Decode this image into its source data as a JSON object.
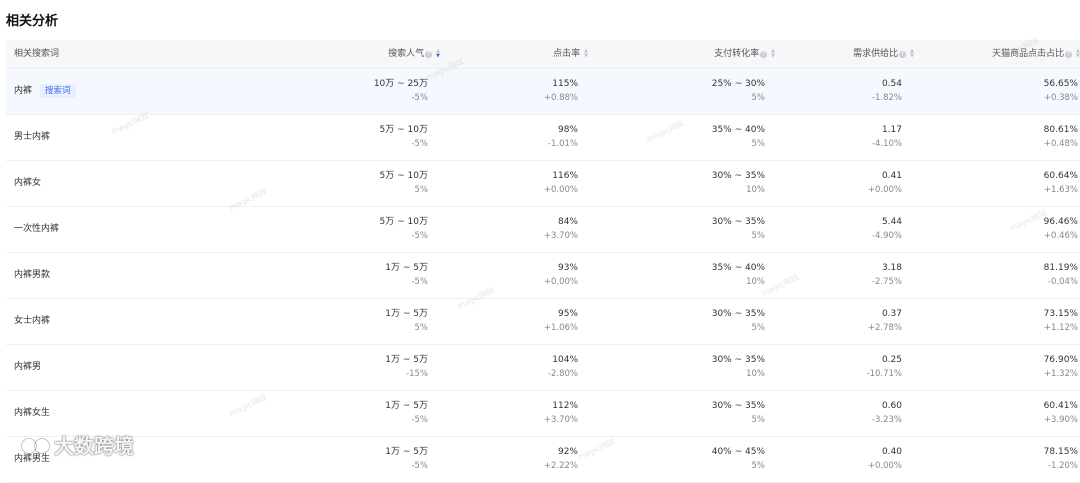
{
  "page": {
    "title": "相关分析"
  },
  "columns": [
    {
      "label": "相关搜索词"
    },
    {
      "label": "搜索人气"
    },
    {
      "label": "点击率"
    },
    {
      "label": "支付转化率"
    },
    {
      "label": "需求供给比"
    },
    {
      "label": "天猫商品点击占比"
    }
  ],
  "tag_label": "搜索词",
  "rows": [
    {
      "term": "内裤",
      "search": "10万 ~ 25万",
      "search_d": "-5%",
      "ctr": "115%",
      "ctr_d": "+0.88%",
      "conv": "25% ~ 30%",
      "conv_d": "5%",
      "sd": "0.54",
      "sd_d": "-1.82%",
      "tmall": "56.65%",
      "tmall_d": "+0.38%"
    },
    {
      "term": "男士内裤",
      "search": "5万 ~ 10万",
      "search_d": "-5%",
      "ctr": "98%",
      "ctr_d": "-1.01%",
      "conv": "35% ~ 40%",
      "conv_d": "5%",
      "sd": "1.17",
      "sd_d": "-4.10%",
      "tmall": "80.61%",
      "tmall_d": "+0.48%"
    },
    {
      "term": "内裤女",
      "search": "5万 ~ 10万",
      "search_d": "5%",
      "ctr": "116%",
      "ctr_d": "+0.00%",
      "conv": "30% ~ 35%",
      "conv_d": "10%",
      "sd": "0.41",
      "sd_d": "+0.00%",
      "tmall": "60.64%",
      "tmall_d": "+1.63%"
    },
    {
      "term": "一次性内裤",
      "search": "5万 ~ 10万",
      "search_d": "-5%",
      "ctr": "84%",
      "ctr_d": "+3.70%",
      "conv": "30% ~ 35%",
      "conv_d": "5%",
      "sd": "5.44",
      "sd_d": "-4.90%",
      "tmall": "96.46%",
      "tmall_d": "+0.46%"
    },
    {
      "term": "内裤男款",
      "search": "1万 ~ 5万",
      "search_d": "-5%",
      "ctr": "93%",
      "ctr_d": "+0.00%",
      "conv": "35% ~ 40%",
      "conv_d": "10%",
      "sd": "3.18",
      "sd_d": "-2.75%",
      "tmall": "81.19%",
      "tmall_d": "-0.04%"
    },
    {
      "term": "女士内裤",
      "search": "1万 ~ 5万",
      "search_d": "5%",
      "ctr": "95%",
      "ctr_d": "+1.06%",
      "conv": "30% ~ 35%",
      "conv_d": "5%",
      "sd": "0.37",
      "sd_d": "+2.78%",
      "tmall": "73.15%",
      "tmall_d": "+1.12%"
    },
    {
      "term": "内裤男",
      "search": "1万 ~ 5万",
      "search_d": "-15%",
      "ctr": "104%",
      "ctr_d": "-2.80%",
      "conv": "30% ~ 35%",
      "conv_d": "10%",
      "sd": "0.25",
      "sd_d": "-10.71%",
      "tmall": "76.90%",
      "tmall_d": "+1.32%"
    },
    {
      "term": "内裤女生",
      "search": "1万 ~ 5万",
      "search_d": "-5%",
      "ctr": "112%",
      "ctr_d": "+3.70%",
      "conv": "30% ~ 35%",
      "conv_d": "5%",
      "sd": "0.60",
      "sd_d": "-3.23%",
      "tmall": "60.41%",
      "tmall_d": "+3.90%"
    },
    {
      "term": "内裤男生",
      "search": "1万 ~ 5万",
      "search_d": "-5%",
      "ctr": "92%",
      "ctr_d": "+2.22%",
      "conv": "40% ~ 45%",
      "conv_d": "5%",
      "sd": "0.40",
      "sd_d": "+0.00%",
      "tmall": "78.15%",
      "tmall_d": "-1.20%"
    }
  ],
  "watermark_text": "magic网奴",
  "logo_text": "大数跨境"
}
